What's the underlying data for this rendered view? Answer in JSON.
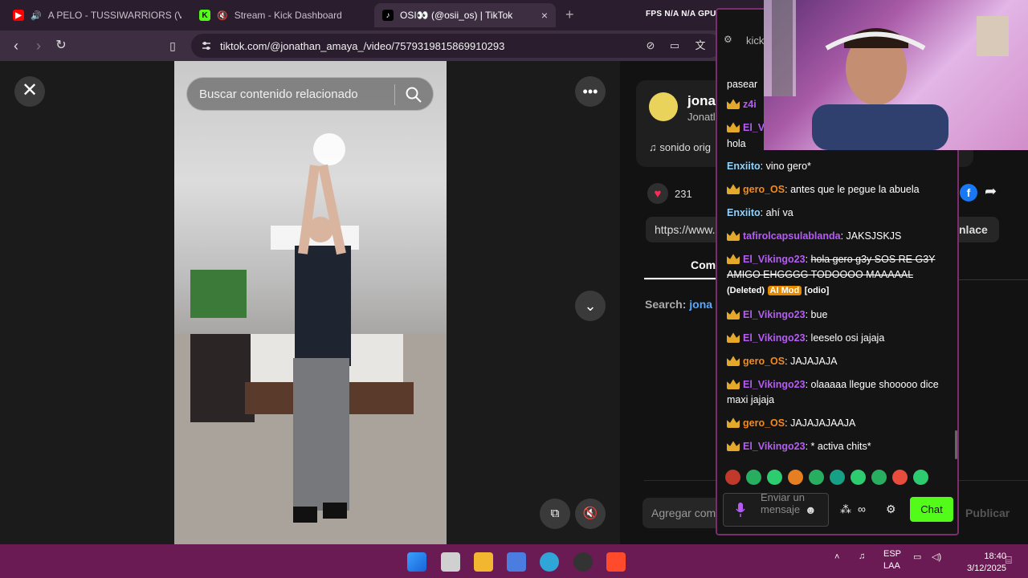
{
  "browser": {
    "tabs": [
      {
        "title": "A PELO - TUSSIWARRIORS (VIDEO",
        "favicon": "youtube-icon",
        "active": false
      },
      {
        "title": "Stream - Kick Dashboard",
        "favicon": "kick-icon",
        "active": false
      },
      {
        "title": "OSI👀 (@osii_os) | TikTok",
        "favicon": "tiktok-icon",
        "active": true
      }
    ],
    "new_tab_label": "+",
    "close_label": "×",
    "fps_readout": "FPS  N/A  N/A   GPU",
    "url": "tiktok.com/@jonathan_amaya_/video/7579319815869910293"
  },
  "video_page": {
    "search_placeholder": "Buscar contenido relacionado",
    "creator_name": "jona",
    "creator_handle": "Jonatl",
    "sound": "♫  sonido orig",
    "likes": "231",
    "link_text": "https://www.",
    "copy_link_label": "nlace",
    "comments_tab": "Come",
    "search_result_prefix": "Search: ",
    "search_result_term": "jona",
    "comment_placeholder": "Agregar come",
    "publish_label": "Publicar"
  },
  "chat": {
    "header_label": "kick",
    "messages": [
      {
        "user": "",
        "text": "pasear",
        "crown": false
      },
      {
        "user": "z4i",
        "text": "",
        "color": "purple",
        "crown": true
      },
      {
        "user": "El_V",
        "text": "",
        "color": "purple",
        "crown": true
      },
      {
        "user": "",
        "text": "hola",
        "crown": false
      },
      {
        "user": "Enxiito",
        "text": "vino gero*",
        "color": "mod",
        "crown": false
      },
      {
        "user": "gero_OS",
        "text": "antes que le pegue la abuela",
        "color": "orange",
        "crown": true
      },
      {
        "user": "Enxiito",
        "text": "ahí va",
        "color": "mod",
        "crown": false
      },
      {
        "user": "tafirolcapsulablanda",
        "text": "JAKSJSKJS",
        "color": "purple",
        "crown": true
      },
      {
        "user": "El_Vikingo23",
        "text": "hola gero g3y SOS RE G3Y AMIGO EHGGGG TODOOOO MAAAAAL",
        "color": "purple",
        "crown": true,
        "deleted": true,
        "tag_deleted": "(Deleted)",
        "tag_aimod": "AI Mod",
        "tag_reason": "[odio]"
      },
      {
        "user": "El_Vikingo23",
        "text": "bue",
        "color": "purple",
        "crown": true
      },
      {
        "user": "El_Vikingo23",
        "text": "leeselo osi jajaja",
        "color": "purple",
        "crown": true
      },
      {
        "user": "gero_OS",
        "text": "JAJAJAJA",
        "color": "orange",
        "crown": true
      },
      {
        "user": "El_Vikingo23",
        "text": "olaaaaa llegue shooooo dice maxi jajaja",
        "color": "purple",
        "crown": true
      },
      {
        "user": "gero_OS",
        "text": "JAJAJAJAAJA",
        "color": "orange",
        "crown": true
      },
      {
        "user": "El_Vikingo23",
        "text": "* activa chits*",
        "color": "purple",
        "crown": true
      }
    ],
    "input_placeholder": "Enviar un mensaje",
    "send_label": "Chat",
    "emote_colors": [
      "#c0392b",
      "#27ae60",
      "#2ecc71",
      "#e67e22",
      "#27ae60",
      "#16a085",
      "#2ecc71",
      "#27ae60",
      "#e74c3c",
      "#2ecc71"
    ]
  },
  "taskbar": {
    "lang": "ESP",
    "layout": "LAA",
    "time": "18:40",
    "date": "3/12/2025"
  }
}
